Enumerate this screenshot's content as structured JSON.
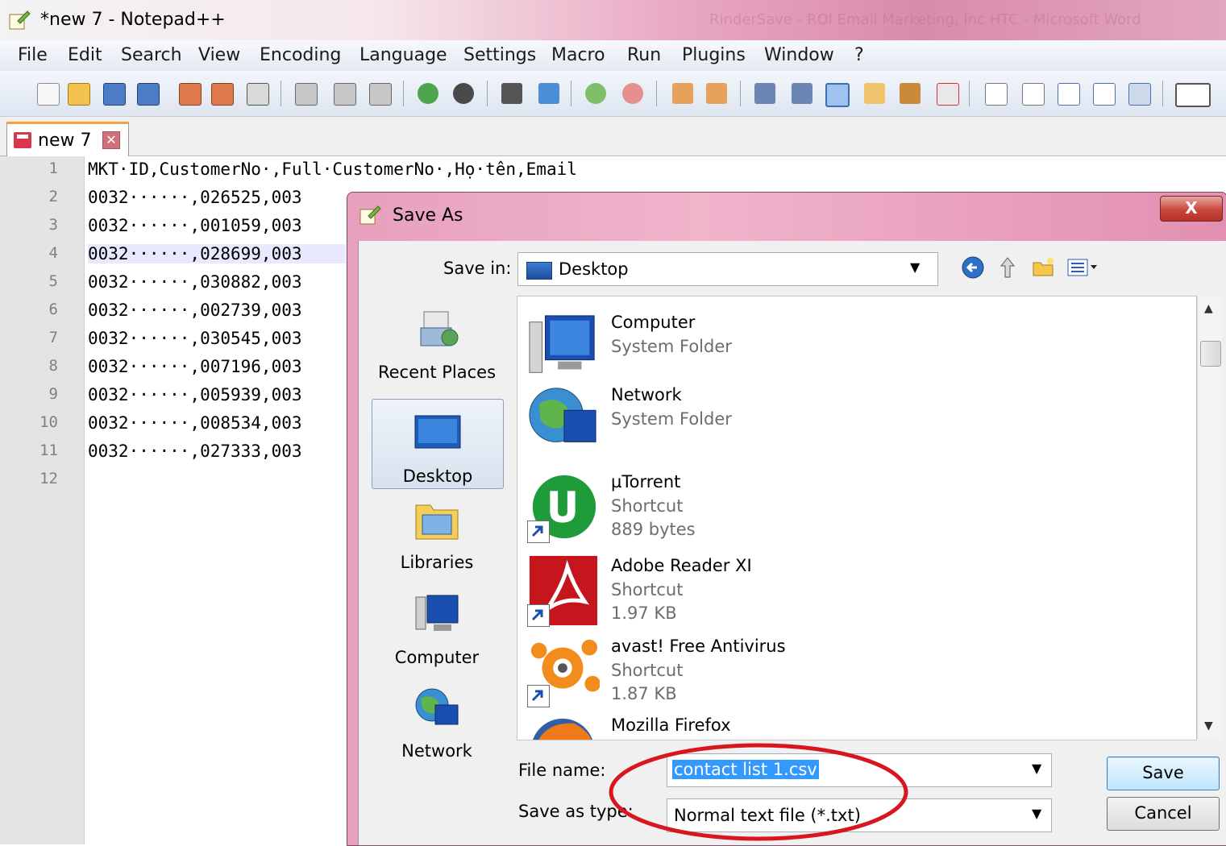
{
  "window": {
    "title": "*new 7 - Notepad++",
    "background_title": "RinderSave - ROI Email Marketing, Inc HTC - Microsoft Word"
  },
  "menu": [
    "File",
    "Edit",
    "Search",
    "View",
    "Encoding",
    "Language",
    "Settings",
    "Macro",
    "Run",
    "Plugins",
    "Window",
    "?"
  ],
  "tab": {
    "label": "new 7",
    "close_label": "✕"
  },
  "editor": {
    "line_numbers": [
      "1",
      "2",
      "3",
      "4",
      "5",
      "6",
      "7",
      "8",
      "9",
      "10",
      "11",
      "12"
    ],
    "lines": [
      "MKT·ID,CustomerNo·,Full·CustomerNo·,Họ·tên,Email",
      "0032······,026525,003",
      "0032······,001059,003",
      "0032······,028699,003",
      "0032······,030882,003",
      "0032······,002739,003",
      "0032······,030545,003",
      "0032······,007196,003",
      "0032······,005939,003",
      "0032······,008534,003",
      "0032······,027333,003",
      ""
    ],
    "current_line": 4
  },
  "dialog": {
    "title": "Save As",
    "close_label": "X",
    "save_in_label": "Save in:",
    "save_in_value": "Desktop",
    "places": [
      "Recent Places",
      "Desktop",
      "Libraries",
      "Computer",
      "Network"
    ],
    "selected_place": "Desktop",
    "files": [
      {
        "name": "Computer",
        "type": "System Folder",
        "size": "",
        "icon": "computer-icon"
      },
      {
        "name": "Network",
        "type": "System Folder",
        "size": "",
        "icon": "network-icon"
      },
      {
        "name": "µTorrent",
        "type": "Shortcut",
        "size": "889 bytes",
        "icon": "utorrent-icon"
      },
      {
        "name": "Adobe Reader XI",
        "type": "Shortcut",
        "size": "1.97 KB",
        "icon": "adobe-reader-icon"
      },
      {
        "name": "avast! Free Antivirus",
        "type": "Shortcut",
        "size": "1.87 KB",
        "icon": "avast-icon"
      },
      {
        "name": "Mozilla Firefox",
        "type": "",
        "size": "",
        "icon": "firefox-icon"
      }
    ],
    "file_name_label": "File name:",
    "file_name_value": "contact list 1.csv",
    "save_type_label": "Save as type:",
    "save_type_value": "Normal text file (*.txt)",
    "save_button": "Save",
    "cancel_button": "Cancel"
  },
  "colors": {
    "annotation_ellipse": "#d9161f",
    "selection": "#3399ff",
    "title_gradient": "#d98bab"
  }
}
